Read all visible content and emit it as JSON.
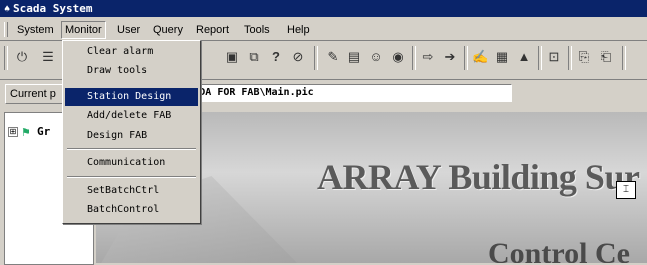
{
  "window": {
    "title": "Scada System",
    "icon": "app-icon"
  },
  "menubar": {
    "items": [
      {
        "label": "System"
      },
      {
        "label": "Monitor"
      },
      {
        "label": "User"
      },
      {
        "label": "Query"
      },
      {
        "label": "Report"
      },
      {
        "label": "Tools"
      },
      {
        "label": "Help"
      }
    ]
  },
  "monitor_menu": {
    "items": [
      {
        "label": "Clear alarm"
      },
      {
        "label": "Draw tools"
      },
      {
        "label": "Station Design",
        "selected": true
      },
      {
        "label": "Add/delete FAB"
      },
      {
        "label": "Design FAB"
      },
      {
        "label": "Communication"
      },
      {
        "label": "SetBatchCtrl"
      },
      {
        "label": "BatchControl"
      }
    ]
  },
  "addressbar": {
    "label": "Current p",
    "path_visible": "LES\\ARRAY\\SCADA FOR FAB\\Main.pic"
  },
  "tree": {
    "expander": "⊞",
    "root_label": "Gr"
  },
  "canvas": {
    "headline": "ARRAY Building Sur",
    "subline": "Control Ce"
  }
}
